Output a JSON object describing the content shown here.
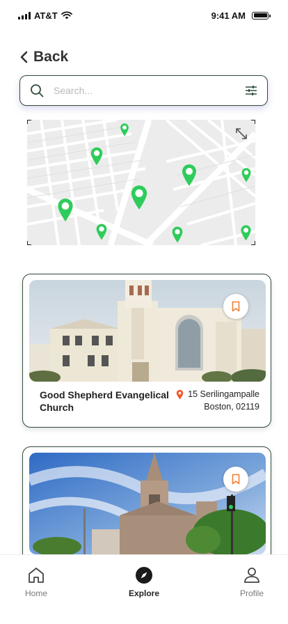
{
  "status_bar": {
    "carrier": "AT&T",
    "time": "9:41 AM"
  },
  "header": {
    "back_label": "Back"
  },
  "search": {
    "placeholder": "Search..."
  },
  "colors": {
    "accent": "#2ecc5a",
    "border": "#2e4a3a",
    "bookmark": "#f07a2b",
    "pin": "#f05a28"
  },
  "churches": [
    {
      "name": "Good Shepherd Evangelical Church",
      "address_line1": "15 Serilingampalle",
      "address_line2": "Boston, 02119"
    },
    {
      "name": "",
      "address_line1": "",
      "address_line2": ""
    }
  ],
  "nav": {
    "items": [
      {
        "label": "Home",
        "icon": "home-icon"
      },
      {
        "label": "Explore",
        "icon": "compass-icon"
      },
      {
        "label": "Profile",
        "icon": "user-icon"
      }
    ],
    "active": "Explore"
  }
}
